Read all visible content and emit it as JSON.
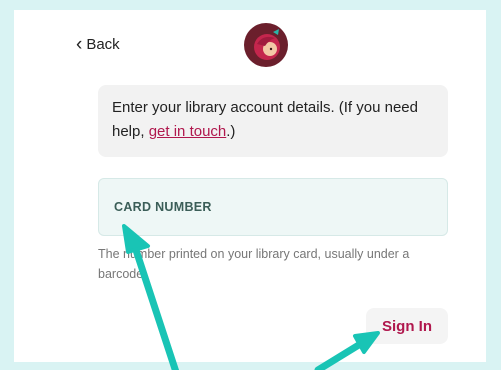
{
  "header": {
    "back_label": "Back"
  },
  "info": {
    "text_before": "Enter your library account details. (If you need help, ",
    "link_text": "get in touch",
    "text_after": ".)"
  },
  "card_field": {
    "label": "CARD NUMBER"
  },
  "help_text": "The number printed on your library card, usually under a barcode.",
  "sign_in_label": "Sign In",
  "colors": {
    "background": "#d9f3f3",
    "accent": "#b0174d",
    "annotation_arrow": "#19c4b5"
  },
  "icons": {
    "back": "chevron-left-icon",
    "logo": "libby-logo-icon",
    "annotations": "arrow-icon"
  }
}
